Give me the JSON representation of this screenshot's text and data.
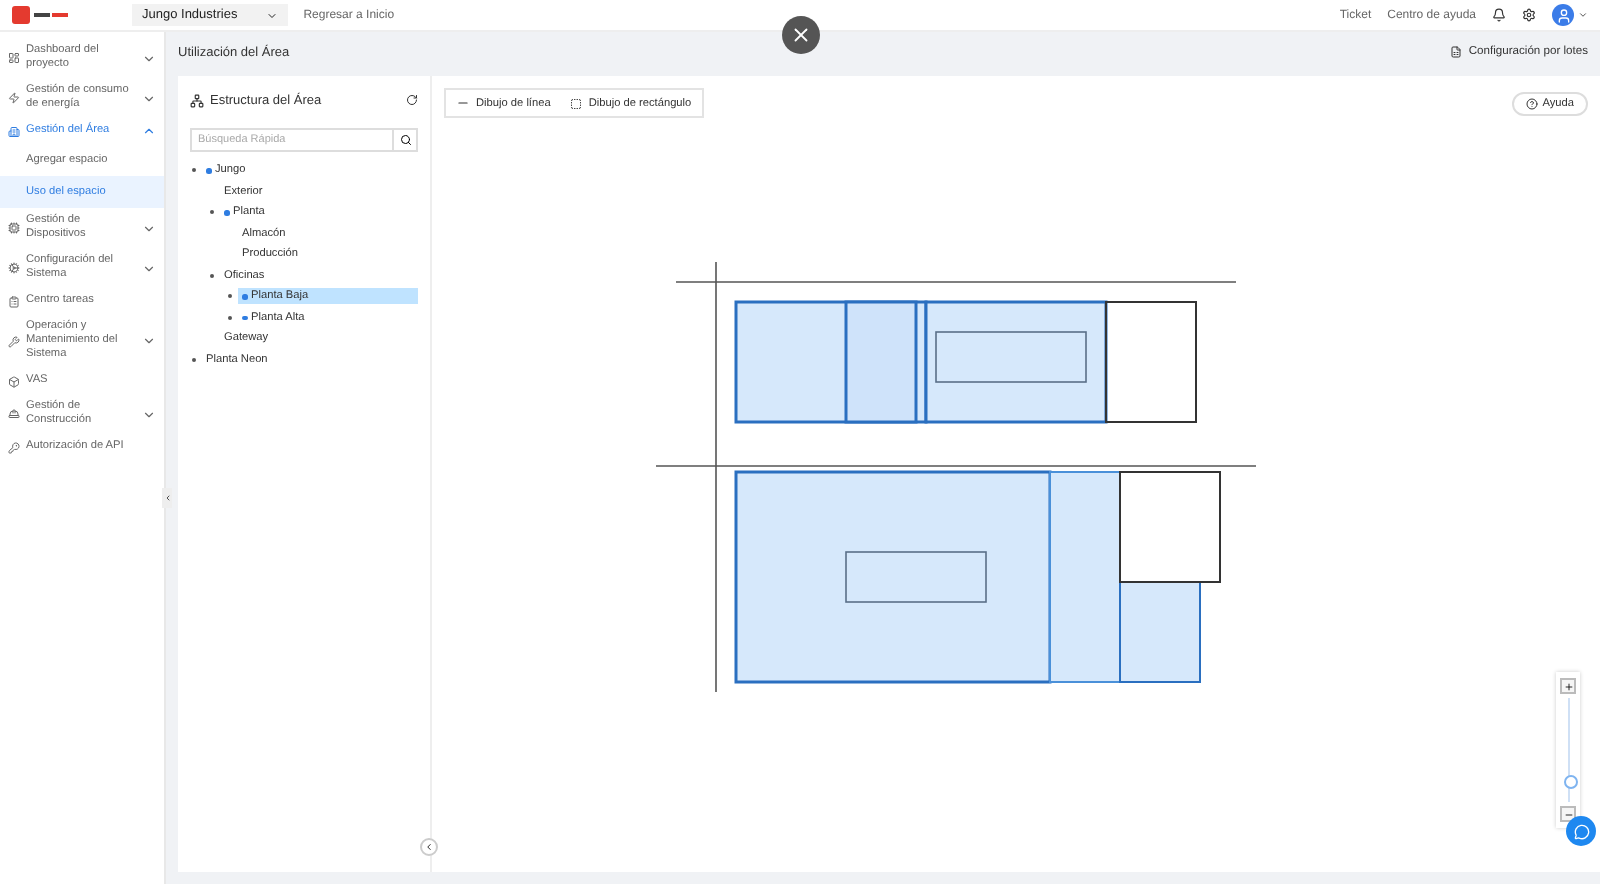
{
  "top_bar": {
    "project": "Jungo Industries",
    "home_link": "Regresar a Inicio",
    "links": [
      "Ticket",
      "Centro de ayuda"
    ]
  },
  "sidebar": {
    "items": [
      {
        "label": "Dashboard del proyecto",
        "expanded": false,
        "selected": false
      },
      {
        "label": "Gestión de consumo de energía",
        "expanded": false,
        "selected": false
      },
      {
        "label": "Gestión del Área",
        "expanded": true,
        "selected": true,
        "children": [
          {
            "label": "Agregar espacio",
            "selected": false
          },
          {
            "label": "Uso del espacio",
            "selected": true
          }
        ]
      },
      {
        "label": "Gestión de Dispositivos",
        "expanded": false,
        "selected": false
      },
      {
        "label": "Configuración del Sistema",
        "expanded": false,
        "selected": false
      },
      {
        "label": "Centro tareas",
        "selected": false
      },
      {
        "label": "Operación y Mantenimiento del Sistema",
        "expanded": false,
        "selected": false
      },
      {
        "label": "VAS",
        "selected": false
      },
      {
        "label": "Gestión de Construcción",
        "expanded": false,
        "selected": false
      },
      {
        "label": "Autorización de API",
        "selected": false
      }
    ]
  },
  "page": {
    "title": "Utilización del Área",
    "batch_button": "Configuración por lotes"
  },
  "tree_panel": {
    "title": "Estructura del Área",
    "search": {
      "placeholder": "Búsqueda Rápida"
    },
    "nodes": [
      {
        "label": "Jungo",
        "toggle": true,
        "marked": true,
        "selected": false,
        "children": [
          {
            "label": "Exterior",
            "toggle": false,
            "marked": false,
            "selected": false
          },
          {
            "label": "Planta",
            "toggle": true,
            "marked": true,
            "selected": false,
            "children": [
              {
                "label": "Almacón",
                "toggle": false,
                "marked": false,
                "selected": false
              },
              {
                "label": "Producción",
                "toggle": false,
                "marked": false,
                "selected": false
              }
            ]
          },
          {
            "label": "Oficinas",
            "toggle": true,
            "marked": false,
            "selected": false,
            "children": [
              {
                "label": "Planta Baja",
                "toggle": true,
                "marked": true,
                "selected": true
              },
              {
                "label": "Planta Alta",
                "toggle": true,
                "marked": true,
                "selected": false
              }
            ]
          },
          {
            "label": "Gateway",
            "toggle": false,
            "marked": false,
            "selected": false
          }
        ]
      },
      {
        "label": "Planta Neon",
        "toggle": true,
        "marked": false,
        "selected": false
      }
    ]
  },
  "toolbar": {
    "tools": [
      {
        "kind": "line",
        "label": "Dibujo de línea"
      },
      {
        "kind": "rect",
        "label": "Dibujo de rectángulo"
      }
    ],
    "help_button": "Ayuda"
  },
  "zoom": {
    "level": 0.2
  }
}
